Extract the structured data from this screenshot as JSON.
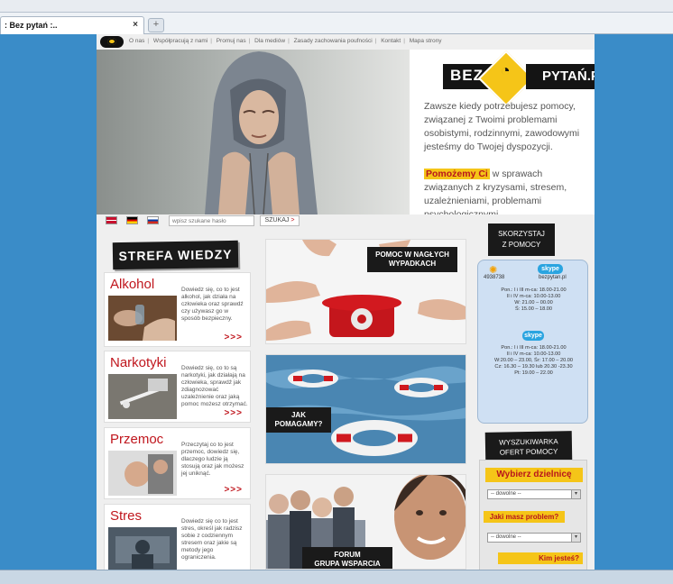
{
  "browser": {
    "tab_title": ": Bez pytań :..",
    "tab_close": "×",
    "new_tab": "+"
  },
  "nav": {
    "links": [
      "O nas",
      "Współpracują z nami",
      "Promuj nas",
      "Dla mediów",
      "Zasady zachowania poufności",
      "Kontakt",
      "Mapa strony"
    ]
  },
  "brand": {
    "left": "BEZ",
    "right": "PYTAŃ.PL"
  },
  "hero": {
    "text1": "Zawsze kiedy potrzebujesz pomocy, związanej z Twoimi problemami osobistymi, rodzinnymi, zawodowymi jesteśmy do Twojej dyspozycji.",
    "highlight": "Pomożemy Ci",
    "text2": " w sprawach związanych z kryzysami, stresem, uzależnieniami, problemami psychologicznymi.."
  },
  "search": {
    "placeholder": "wpisz szukane hasło",
    "button": "SZUKAJ",
    "button_arrow": ">"
  },
  "left": {
    "heading": "STREFA WIEDZY",
    "more": ">>>",
    "cards": [
      {
        "title": "Alkohol",
        "desc": "Dowiedz się, co to jest alkohol, jak działa na człowieka oraz sprawdź czy używasz go w sposób bezpieczny."
      },
      {
        "title": "Narkotyki",
        "desc": "Dowiedz się, co to są narkotyki, jak działają na człowieka, sprawdź jak zdiagnozować uzależnienie oraz jaką pomoc możesz otrzymać."
      },
      {
        "title": "Przemoc",
        "desc": "Przeczytaj co to jest przemoc, dowiedz się, dlaczego ludzie ją stosują oraz jak możesz jej uniknąć."
      },
      {
        "title": "Stres",
        "desc": "Dowiedz się co to jest stres, określ jak radzisz sobie z codziennym stresem oraz jakie są metody jego ograniczenia."
      }
    ]
  },
  "middle": {
    "tile1": "POMOC W NAGŁYCH WYPADKACH",
    "tile2": "JAK POMAGAMY?",
    "tile3_line1": "FORUM",
    "tile3_line2": "GRUPA WSPARCIA"
  },
  "right": {
    "skorzystaj": [
      "SKORZYSTAJ",
      "Z POMOCY"
    ],
    "gg_number": "4938738",
    "skype_logo": "skype",
    "skype_name": "bezpytan.pl",
    "gg_hours": [
      "Pon.: I i III m-ca: 18.00-21.00",
      "II i IV m-ca: 10.00-13.00",
      "W: 21.00 – 00.00",
      "Ś: 15.00 – 18.00"
    ],
    "skype_hours": [
      "Pon.: I i III m-ca: 18.00-21.00",
      "II i IV m-ca: 10.00-13.00",
      "W:20.00 – 23.00, Śr: 17.00 – 20.00",
      "Cz: 16.30 – 19.30 lub 20.30 -23.30",
      "Pt: 19.00 – 22.00"
    ],
    "wyszukiwarka": [
      "WYSZUKIWARKA",
      "OFERT POMOCY"
    ],
    "wybierz": "Wybierz dzielnicę",
    "select_value": "-- dowolne --",
    "jaki": "Jaki masz problem?",
    "kim": "Kim jesteś?"
  },
  "colors": {
    "accent_red": "#c0161d",
    "accent_yellow": "#f5c518",
    "page_bg": "#3a8cc8"
  }
}
